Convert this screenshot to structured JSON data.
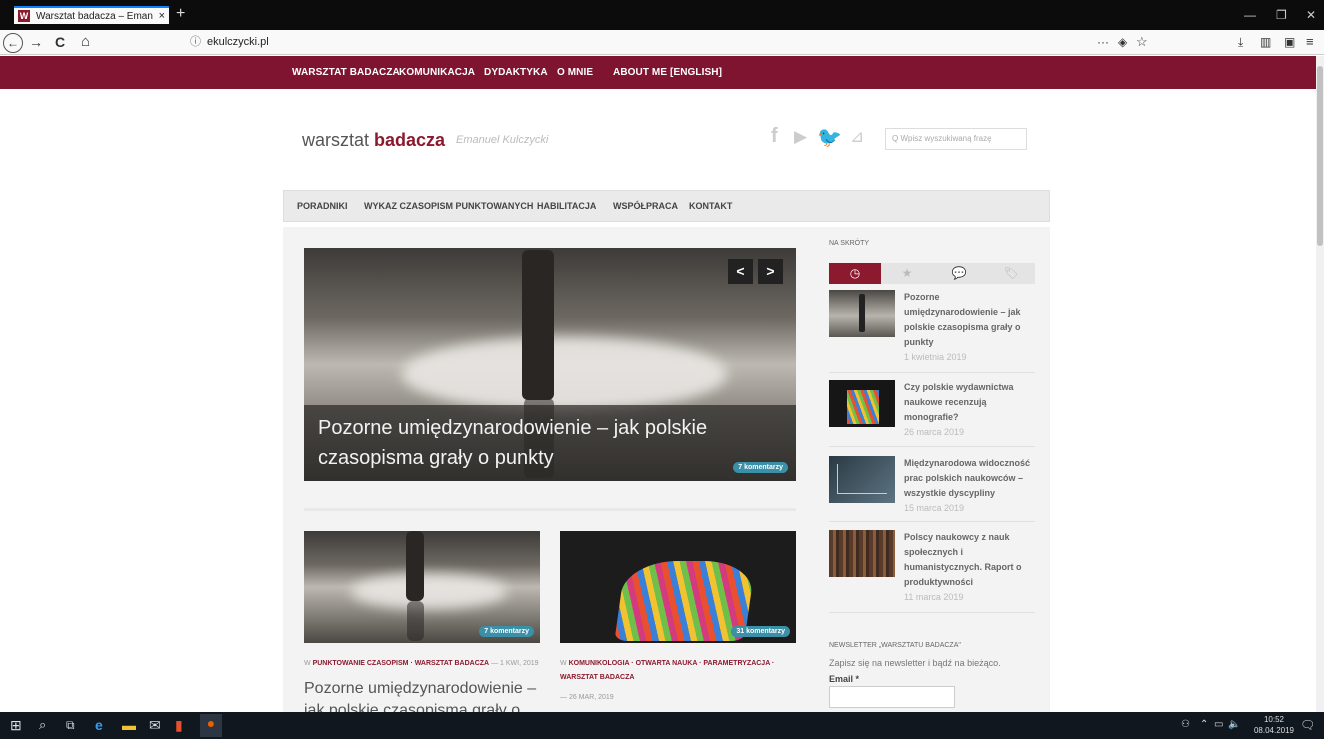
{
  "browser": {
    "tab_title": "Warsztat badacza – Emanuel Ku",
    "tab_close": "×",
    "new_tab": "+",
    "url": "ekulczycki.pl",
    "back": "←",
    "forward": "→",
    "reload": "C",
    "home": "⌂",
    "more": "···"
  },
  "site_nav": [
    "WARSZTAT BADACZA",
    "KOMUNIKACJA",
    "DYDAKTYKA",
    "O MNIE",
    "ABOUT ME [ENGLISH]"
  ],
  "header": {
    "logo_normal": "warsztat ",
    "logo_bold": "badacza",
    "tagline": "Emanuel Kulczycki",
    "search_placeholder": "Q Wpisz wyszukiwaną frazę"
  },
  "menu": [
    "PORADNIKI",
    "WYKAZ CZASOPISM PUNKTOWANYCH",
    "HABILITACJA",
    "WSPÓŁPRACA",
    "KONTAKT"
  ],
  "hero": {
    "title": "Pozorne umiędzynarodowienie – jak polskie czasopisma grały o punkty",
    "comments": "7 komentarzy",
    "prev": "<",
    "next": ">"
  },
  "cards": [
    {
      "comments": "7 komentarzy",
      "meta_prefix": "W",
      "cats": "PUNKTOWANIE CZASOPISM · WARSZTAT BADACZA",
      "date": "— 1 KWI, 2019",
      "title": "Pozorne umiędzynarodowienie – jak polskie czasopisma grały o"
    },
    {
      "comments": "31 komentarzy",
      "meta_prefix": "W",
      "cats": "KOMUNIKOLOGIA · OTWARTA NAUKA · PARAMETRYZACJA · WARSZTAT BADACZA",
      "date": "— 26 MAR, 2019",
      "title": ""
    }
  ],
  "sidebar": {
    "heading": "NA SKRÓTY",
    "items": [
      {
        "title": "Pozorne umiędzynarodowienie – jak polskie czasopisma grały o punkty",
        "date": "1 kwietnia 2019"
      },
      {
        "title": "Czy polskie wydawnictwa naukowe recenzują monografie?",
        "date": "26 marca 2019"
      },
      {
        "title": "Międzynarodowa widoczność prac polskich naukowców – wszystkie dyscypliny",
        "date": "15 marca 2019"
      },
      {
        "title": "Polscy naukowcy z nauk społecznych i humanistycznych. Raport o produktywności",
        "date": "11 marca 2019"
      }
    ],
    "newsletter_heading": "NEWSLETTER „WARSZTATU BADACZA\"",
    "newsletter_text": "Zapisz się na newsletter i bądź na bieżąco.",
    "email_label": "Email *"
  },
  "taskbar": {
    "time": "10:52",
    "date": "08.04.2019"
  },
  "colors": {
    "brand": "#7e1430",
    "badge": "#3b8fa6"
  }
}
